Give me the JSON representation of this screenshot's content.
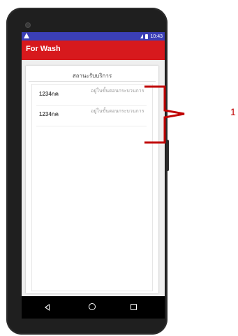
{
  "app_bar": {
    "title": "For Wash"
  },
  "status_bar": {
    "time": "10:43"
  },
  "card": {
    "title": "สถานะรับบริการ",
    "rows": [
      {
        "code": "1234กค",
        "status": "อยู่ในขั้นตอนกระบวนการ"
      },
      {
        "code": "1234กค",
        "status": "อยู่ในขั้นตอนกระบวนการ"
      }
    ]
  },
  "annotation": {
    "label": "1",
    "color": "#c00000"
  },
  "colors": {
    "status_bar": "#3b3fb5",
    "app_bar": "#d7191d",
    "background": "#efefef"
  },
  "icons": [
    "notification-icon",
    "wifi-icon",
    "battery-icon",
    "back-icon",
    "home-icon",
    "recents-icon"
  ]
}
